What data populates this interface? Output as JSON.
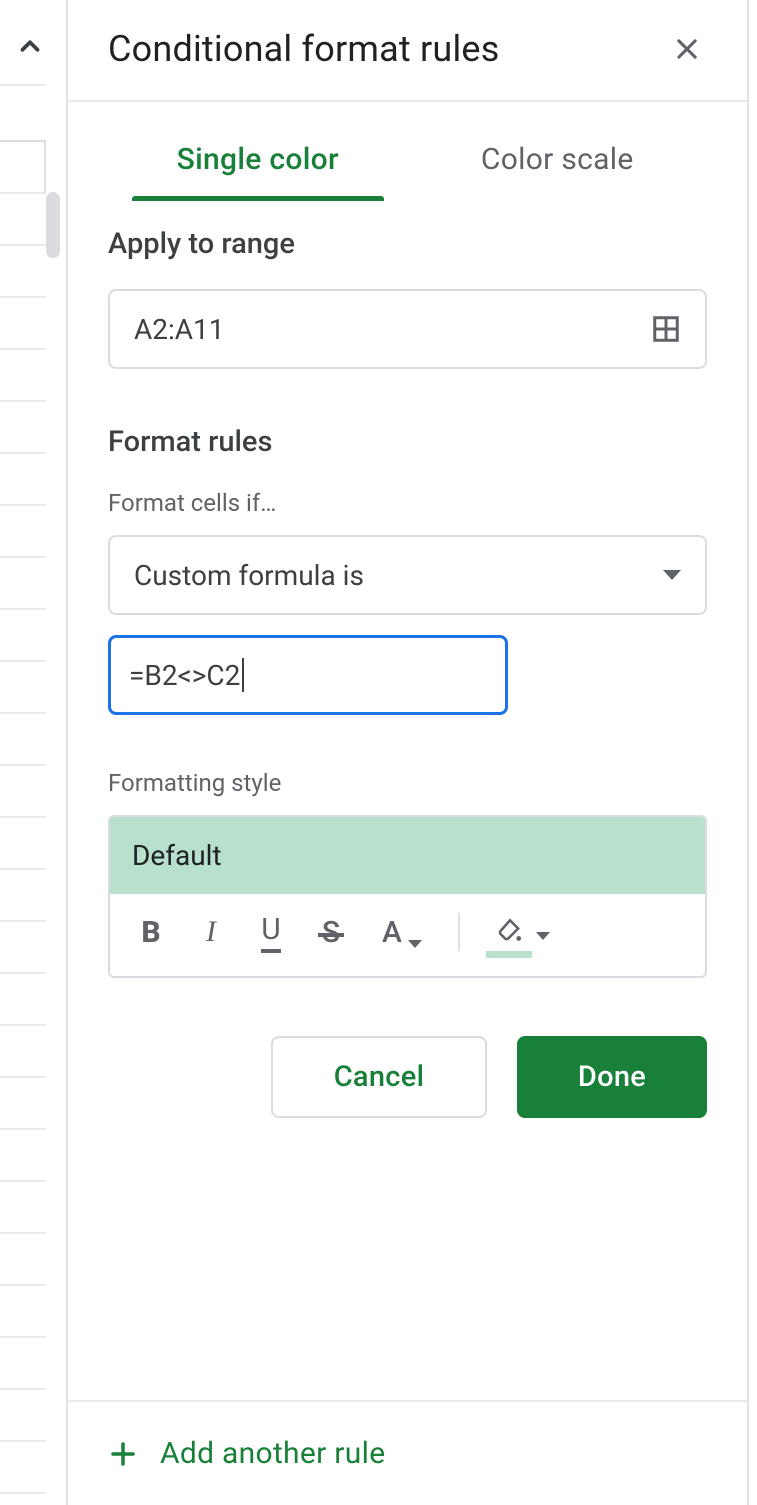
{
  "header": {
    "title": "Conditional format rules"
  },
  "tabs": {
    "single_color": "Single color",
    "color_scale": "Color scale"
  },
  "range": {
    "section_title": "Apply to range",
    "value": "A2:A11"
  },
  "rules": {
    "section_title": "Format rules",
    "condition_label": "Format cells if…",
    "condition_value": "Custom formula is",
    "formula_value": "=B2<>C2"
  },
  "style": {
    "section_label": "Formatting style",
    "preview_label": "Default",
    "toolbar": {
      "bold": "B",
      "italic": "I",
      "underline": "U",
      "strike": "S",
      "textcolor": "A"
    }
  },
  "footer": {
    "cancel": "Cancel",
    "done": "Done",
    "add_rule": "Add another rule"
  },
  "colors": {
    "accent": "#188038",
    "focus": "#1a73e8",
    "preview_fill": "#b7e1cd"
  }
}
